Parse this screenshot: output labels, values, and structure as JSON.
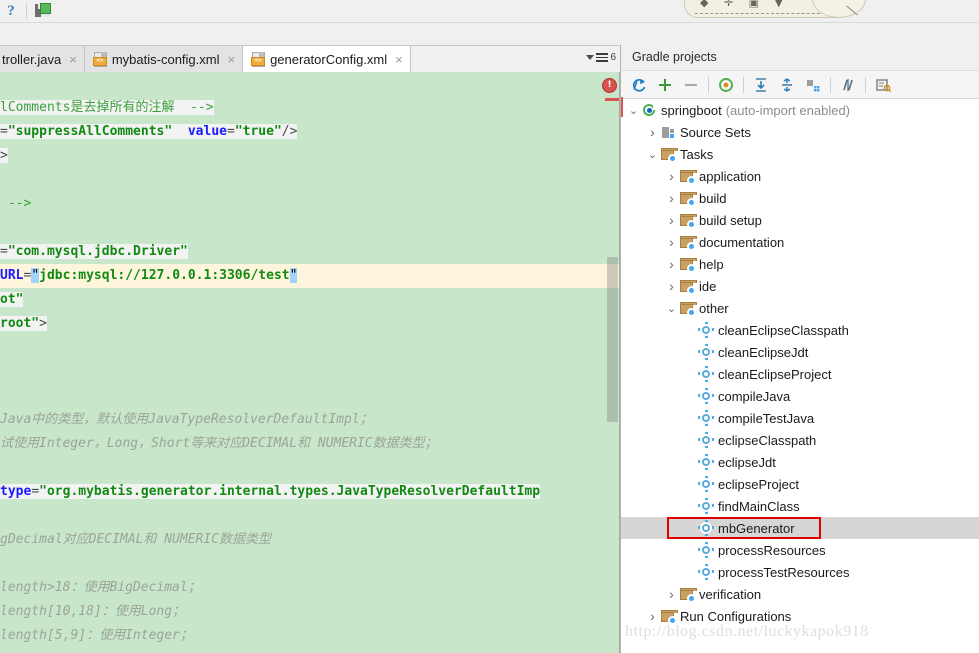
{
  "toolbar": {
    "help_icon": "help-question-icon",
    "save_all_icon": "save-all-icon",
    "balloon_glyphs": "◆ ✛ ▣ ▼"
  },
  "tabs": {
    "items": [
      {
        "label": "troller.java",
        "icon": "java-file-icon",
        "active": false,
        "truncated": true
      },
      {
        "label": "mybatis-config.xml",
        "icon": "xml-file-icon",
        "active": false,
        "truncated": false
      },
      {
        "label": "generatorConfig.xml",
        "icon": "xml-file-icon",
        "active": true,
        "truncated": false
      }
    ],
    "close_glyph": "×",
    "overflow_count": "6"
  },
  "editor": {
    "background_color": "#c8e6c9",
    "error_badge": "!",
    "lines": [
      {
        "bg": "none",
        "parts": [
          {
            "t": "",
            "c": "plain"
          }
        ]
      },
      {
        "bg": "white",
        "parts": [
          {
            "t": "lComments是去掉所有的注解  -->",
            "c": "cmt-d"
          }
        ]
      },
      {
        "bg": "white",
        "parts": [
          {
            "t": "=",
            "c": "tagpunc"
          },
          {
            "t": "\"suppressAllComments\"",
            "c": "val"
          },
          {
            "t": "  ",
            "c": "plain"
          },
          {
            "t": "value",
            "c": "attr"
          },
          {
            "t": "=",
            "c": "tagpunc"
          },
          {
            "t": "\"true\"",
            "c": "val"
          },
          {
            "t": "/>",
            "c": "tagpunc"
          }
        ]
      },
      {
        "bg": "white-short",
        "parts": [
          {
            "t": ">",
            "c": "tagpunc"
          }
        ]
      },
      {
        "bg": "none",
        "parts": [
          {
            "t": "",
            "c": "plain"
          }
        ]
      },
      {
        "bg": "none",
        "parts": [
          {
            "t": " -->",
            "c": "cmt-d"
          }
        ]
      },
      {
        "bg": "none",
        "parts": [
          {
            "t": "",
            "c": "plain"
          }
        ]
      },
      {
        "bg": "white",
        "parts": [
          {
            "t": "=",
            "c": "tagpunc"
          },
          {
            "t": "\"com.mysql.jdbc.Driver\"",
            "c": "val"
          }
        ]
      },
      {
        "bg": "caret",
        "parts": [
          {
            "t": "URL",
            "c": "attr"
          },
          {
            "t": "=",
            "c": "tagpunc"
          },
          {
            "t": "\"",
            "c": "bracket"
          },
          {
            "t": "jdbc:mysql://127.0.0.1:3306/test",
            "c": "val"
          },
          {
            "t": "\"",
            "c": "bracket"
          }
        ]
      },
      {
        "bg": "white",
        "parts": [
          {
            "t": "ot\"",
            "c": "val"
          }
        ]
      },
      {
        "bg": "white-short",
        "parts": [
          {
            "t": "root\"",
            "c": "val"
          },
          {
            "t": ">",
            "c": "tagpunc"
          }
        ]
      },
      {
        "bg": "none",
        "parts": [
          {
            "t": "",
            "c": "plain"
          }
        ]
      },
      {
        "bg": "none",
        "parts": [
          {
            "t": "",
            "c": "plain"
          }
        ]
      },
      {
        "bg": "none",
        "parts": [
          {
            "t": "",
            "c": "plain"
          }
        ]
      },
      {
        "bg": "none",
        "parts": [
          {
            "t": "Java中的类型，默认使用JavaTypeResolverDefaultImpl；",
            "c": "cmt"
          }
        ]
      },
      {
        "bg": "none",
        "parts": [
          {
            "t": "试使用Integer，Long，Short等来对应DECIMAL和 NUMERIC数据类型；",
            "c": "cmt"
          }
        ]
      },
      {
        "bg": "none",
        "parts": [
          {
            "t": "",
            "c": "plain"
          }
        ]
      },
      {
        "bg": "white",
        "parts": [
          {
            "t": "type",
            "c": "attr"
          },
          {
            "t": "=",
            "c": "tagpunc"
          },
          {
            "t": "\"org.mybatis.generator.internal.types.JavaTypeResolverDefaultImp",
            "c": "val"
          }
        ]
      },
      {
        "bg": "none",
        "parts": [
          {
            "t": "",
            "c": "plain"
          }
        ]
      },
      {
        "bg": "none",
        "parts": [
          {
            "t": "gDecimal对应DECIMAL和 NUMERIC数据类型",
            "c": "cmt"
          }
        ]
      },
      {
        "bg": "none",
        "parts": [
          {
            "t": "",
            "c": "plain"
          }
        ]
      },
      {
        "bg": "none",
        "parts": [
          {
            "t": "length>18：使用BigDecimal；",
            "c": "cmt"
          }
        ]
      },
      {
        "bg": "none",
        "parts": [
          {
            "t": "length[10,18]：使用Long；",
            "c": "cmt"
          }
        ]
      },
      {
        "bg": "none",
        "parts": [
          {
            "t": "length[5,9]：使用Integer；",
            "c": "cmt"
          }
        ]
      }
    ]
  },
  "gradle": {
    "title": "Gradle projects",
    "toolbar_icons": [
      {
        "name": "refresh-icon",
        "glyph": "⟳"
      },
      {
        "name": "add-icon",
        "glyph": "+"
      },
      {
        "name": "remove-icon",
        "glyph": "−"
      },
      {
        "name": "execute-task-icon",
        "glyph": "◉"
      },
      {
        "name": "expand-all-icon",
        "glyph": "⤓"
      },
      {
        "name": "collapse-all-icon",
        "glyph": "⤒"
      },
      {
        "name": "toggle-offline-icon",
        "glyph": "▞"
      },
      {
        "name": "skip-tests-icon",
        "glyph": "⫽"
      },
      {
        "name": "settings-icon",
        "glyph": "⚙"
      }
    ],
    "tree": [
      {
        "label": "springboot",
        "suffix": "(auto-import enabled)",
        "icon": "gradle-project-icon",
        "arrow": "down",
        "indent": 0
      },
      {
        "label": "Source Sets",
        "icon": "source-sets-icon",
        "arrow": "right",
        "indent": 1
      },
      {
        "label": "Tasks",
        "icon": "tasks-folder-icon",
        "arrow": "down",
        "indent": 1
      },
      {
        "label": "application",
        "icon": "tasks-folder-icon",
        "arrow": "right",
        "indent": 2
      },
      {
        "label": "build",
        "icon": "tasks-folder-icon",
        "arrow": "right",
        "indent": 2
      },
      {
        "label": "build setup",
        "icon": "tasks-folder-icon",
        "arrow": "right",
        "indent": 2
      },
      {
        "label": "documentation",
        "icon": "tasks-folder-icon",
        "arrow": "right",
        "indent": 2
      },
      {
        "label": "help",
        "icon": "tasks-folder-icon",
        "arrow": "right",
        "indent": 2
      },
      {
        "label": "ide",
        "icon": "tasks-folder-icon",
        "arrow": "right",
        "indent": 2
      },
      {
        "label": "other",
        "icon": "tasks-folder-icon",
        "arrow": "down",
        "indent": 2
      },
      {
        "label": "cleanEclipseClasspath",
        "icon": "gradle-task-icon",
        "arrow": "none",
        "indent": 3
      },
      {
        "label": "cleanEclipseJdt",
        "icon": "gradle-task-icon",
        "arrow": "none",
        "indent": 3
      },
      {
        "label": "cleanEclipseProject",
        "icon": "gradle-task-icon",
        "arrow": "none",
        "indent": 3
      },
      {
        "label": "compileJava",
        "icon": "gradle-task-icon",
        "arrow": "none",
        "indent": 3
      },
      {
        "label": "compileTestJava",
        "icon": "gradle-task-icon",
        "arrow": "none",
        "indent": 3
      },
      {
        "label": "eclipseClasspath",
        "icon": "gradle-task-icon",
        "arrow": "none",
        "indent": 3
      },
      {
        "label": "eclipseJdt",
        "icon": "gradle-task-icon",
        "arrow": "none",
        "indent": 3
      },
      {
        "label": "eclipseProject",
        "icon": "gradle-task-icon",
        "arrow": "none",
        "indent": 3
      },
      {
        "label": "findMainClass",
        "icon": "gradle-task-icon",
        "arrow": "none",
        "indent": 3
      },
      {
        "label": "mbGenerator",
        "icon": "gradle-task-icon",
        "arrow": "none",
        "indent": 3,
        "selected": true,
        "highlight_box": true
      },
      {
        "label": "processResources",
        "icon": "gradle-task-icon",
        "arrow": "none",
        "indent": 3
      },
      {
        "label": "processTestResources",
        "icon": "gradle-task-icon",
        "arrow": "none",
        "indent": 3
      },
      {
        "label": "verification",
        "icon": "tasks-folder-icon",
        "arrow": "right",
        "indent": 2
      },
      {
        "label": "Run Configurations",
        "icon": "tasks-folder-icon",
        "arrow": "right",
        "indent": 1
      }
    ],
    "highlight_color": "#e00000",
    "selection_color": "#d6d6d6"
  },
  "watermark": {
    "text": "http://blog.csdn.net/luckykapok918"
  }
}
